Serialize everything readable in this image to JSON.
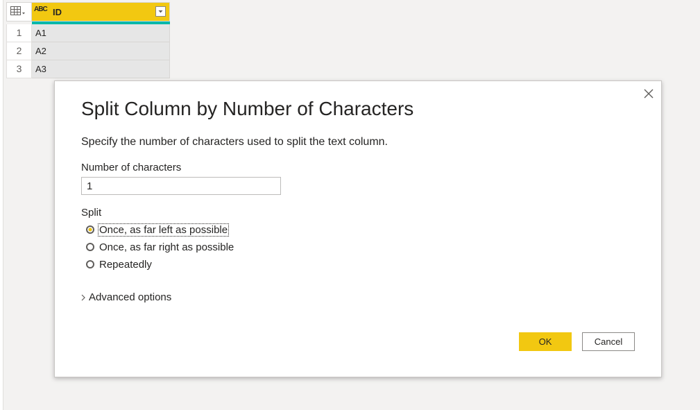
{
  "grid": {
    "corner_icon": "table-icon",
    "column": {
      "type_icon": "ABC",
      "title": "ID",
      "dropdown_icon": "chevron-down-icon"
    },
    "rows": [
      {
        "num": "1",
        "value": "A1"
      },
      {
        "num": "2",
        "value": "A2"
      },
      {
        "num": "3",
        "value": "A3"
      }
    ]
  },
  "dialog": {
    "title": "Split Column by Number of Characters",
    "description": "Specify the number of characters used to split the text column.",
    "number_label": "Number of characters",
    "number_value": "1",
    "split_label": "Split",
    "options": [
      {
        "label": "Once, as far left as possible",
        "selected": true
      },
      {
        "label": "Once, as far right as possible",
        "selected": false
      },
      {
        "label": "Repeatedly",
        "selected": false
      }
    ],
    "advanced_label": "Advanced options",
    "ok_label": "OK",
    "cancel_label": "Cancel"
  },
  "colors": {
    "accent": "#f2c811",
    "teal": "#01b8aa"
  }
}
